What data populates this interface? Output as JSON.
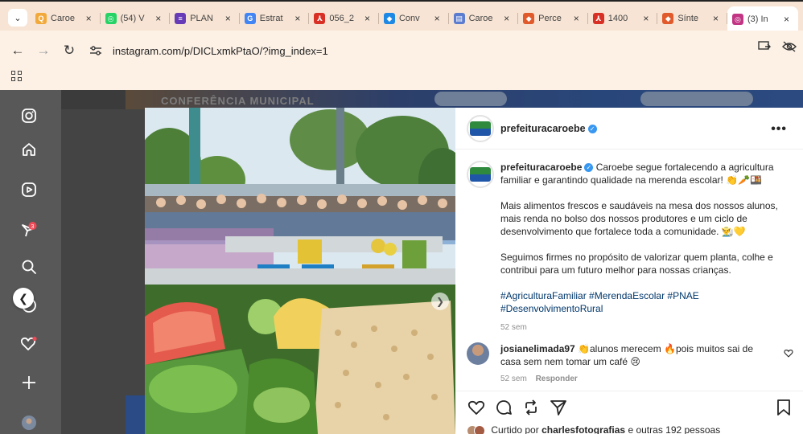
{
  "browser": {
    "tabs": [
      {
        "label": "Caroe",
        "favicon_color": "#f2a93b",
        "favicon_glyph": "search-icon"
      },
      {
        "label": "(54) V",
        "favicon_color": "#25d366",
        "favicon_glyph": "whatsapp-icon"
      },
      {
        "label": "PLAN",
        "favicon_color": "#673ab7",
        "favicon_glyph": "forms-icon"
      },
      {
        "label": "Estrat",
        "favicon_color": "#4285f4",
        "favicon_glyph": "google-icon"
      },
      {
        "label": "056_2",
        "favicon_color": "#d93025",
        "favicon_glyph": "pdf-icon"
      },
      {
        "label": "Conv",
        "favicon_color": "#1e88e5",
        "favicon_glyph": "gem-icon"
      },
      {
        "label": "Caroe",
        "favicon_color": "#5c7ccf",
        "favicon_glyph": "page-icon"
      },
      {
        "label": "Perce",
        "favicon_color": "#e05a2b",
        "favicon_glyph": "compass-icon"
      },
      {
        "label": "1400",
        "favicon_color": "#d93025",
        "favicon_glyph": "pdf-icon"
      },
      {
        "label": "Sínte",
        "favicon_color": "#e05a2b",
        "favicon_glyph": "compass-icon"
      },
      {
        "label": "(3) In",
        "favicon_color": "#c13584",
        "favicon_glyph": "instagram-icon",
        "active": true
      }
    ],
    "url": "instagram.com/p/DICLxmkPtaO/?img_index=1"
  },
  "background": {
    "banner_text": "CONFERÊNCIA MUNICIPAL"
  },
  "post": {
    "account": "prefeituracaroebe",
    "more_label": "•••",
    "caption_line1": "Caroebe segue fortalecendo a agricultura familiar e garantindo qualidade na merenda escolar! 👏🥕🍱",
    "caption_p2": "Mais alimentos frescos e saudáveis na mesa dos nossos alunos, mais renda no bolso dos nossos produtores e um ciclo de desenvolvimento que fortalece toda a comunidade. 👨‍🌾💛",
    "caption_p3": "Seguimos firmes no propósito de valorizar quem planta, colhe e contribui para um futuro melhor para nossas crianças.",
    "hashtags": "#AgriculturaFamiliar #MerendaEscolar #PNAE #DesenvolvimentoRural",
    "time_ago": "52 sem",
    "comment": {
      "user": "josianelimada97",
      "text": "👏alunos merecem 🔥pois muitos sai de casa sem nem tomar um café 😢",
      "time_ago": "52 sem",
      "reply_label": "Responder"
    },
    "liked_prefix": "Curtido por",
    "liked_user": "charlesfotografias",
    "liked_suffix": "e outras 192 pessoas"
  },
  "colors": {
    "tabstrip": "#f7e4d4",
    "toolbar": "#fdf1e6",
    "link": "#00376b",
    "verified": "#3897f0",
    "notification": "#ed4956"
  }
}
